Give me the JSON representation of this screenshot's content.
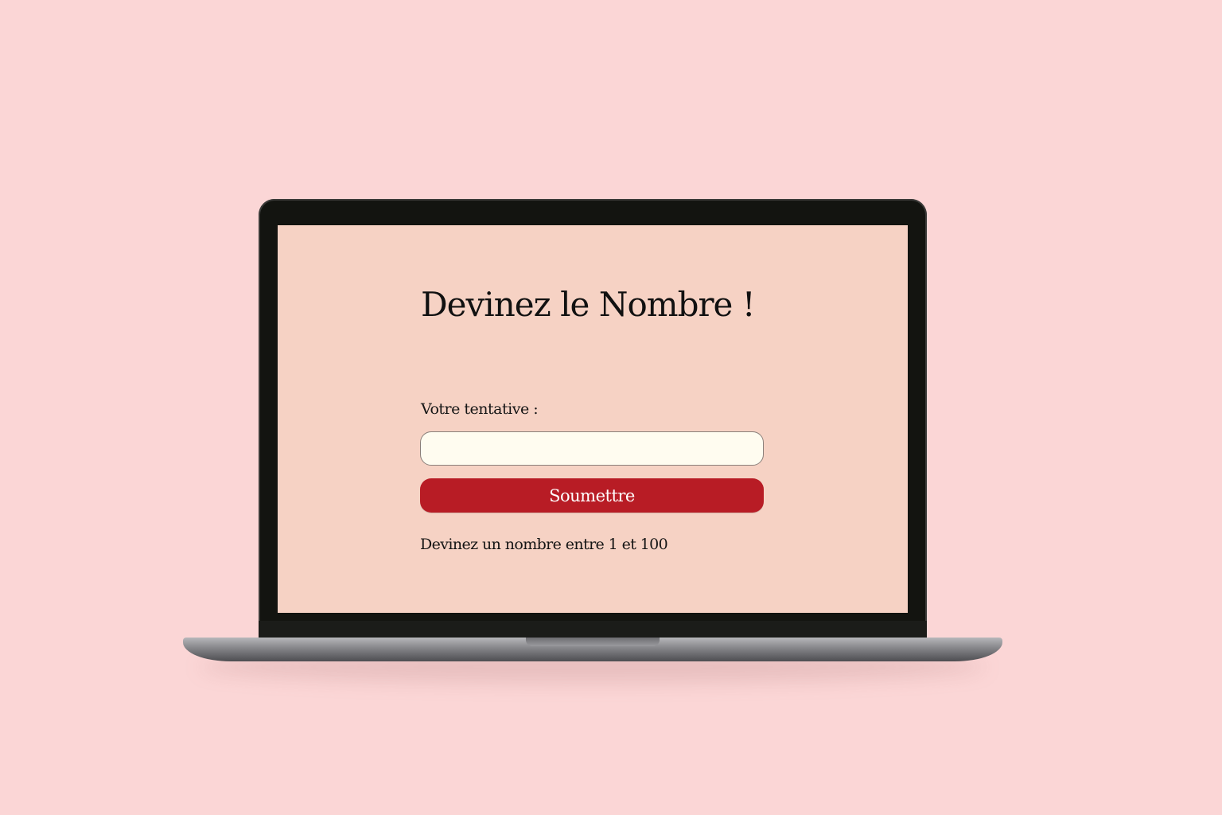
{
  "colors": {
    "background": "#fbd6d6",
    "screen": "#f6d2c4",
    "input_bg": "#fffcf0",
    "button": "#b81c25",
    "button_text": "#ffffff"
  },
  "game": {
    "title": "Devinez le Nombre !",
    "guess_label": "Votre tentative :",
    "guess_input": {
      "value": "",
      "placeholder": ""
    },
    "submit_label": "Soumettre",
    "hint": "Devinez un nombre entre 1 et 100"
  }
}
